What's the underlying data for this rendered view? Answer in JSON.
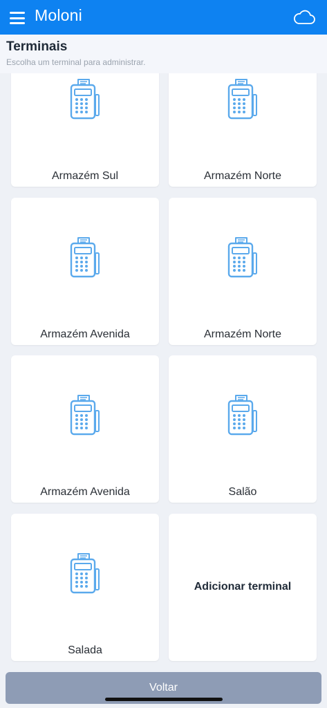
{
  "appbar": {
    "title": "Moloni",
    "menu_icon": "menu-icon",
    "sync_icon": "cloud-icon"
  },
  "page": {
    "title": "Terminais",
    "subtitle": "Escolha um terminal para administrar."
  },
  "terminals": [
    {
      "label": "Armazém Sul",
      "icon": "pos-terminal-icon"
    },
    {
      "label": "Armazém Norte",
      "icon": "pos-terminal-icon"
    },
    {
      "label": "Armazém Avenida",
      "icon": "pos-terminal-icon"
    },
    {
      "label": "Armazém Norte",
      "icon": "pos-terminal-icon"
    },
    {
      "label": "Armazém Avenida",
      "icon": "pos-terminal-icon"
    },
    {
      "label": "Salão",
      "icon": "pos-terminal-icon"
    },
    {
      "label": "Salada",
      "icon": "pos-terminal-icon"
    }
  ],
  "add_terminal": {
    "label": "Adicionar terminal"
  },
  "footer": {
    "back_label": "Voltar"
  },
  "colors": {
    "accent": "#0e82f1",
    "icon": "#5aa9ec",
    "back_button": "#8e9cb5"
  }
}
